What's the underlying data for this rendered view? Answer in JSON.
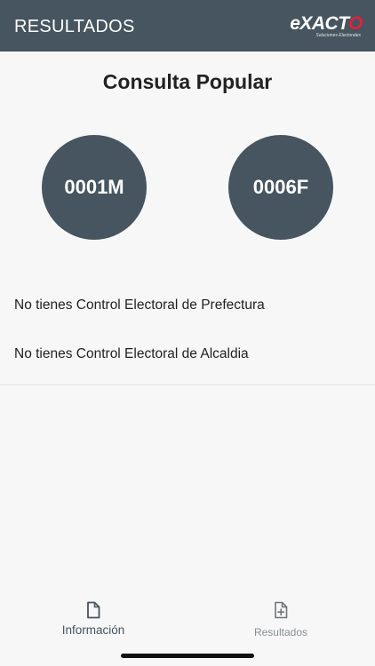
{
  "header": {
    "title": "RESULTADOS",
    "logo_text_main": "eXACT",
    "logo_text_accent": "O",
    "logo_tagline": "Soluciones Electorales",
    "background_color": "#46555f",
    "logo_accent_color": "#e0223a"
  },
  "main": {
    "title": "Consulta Popular",
    "codes": [
      "0001M",
      "0006F"
    ],
    "messages": [
      "No tienes Control Electoral de Prefectura",
      "No tienes Control Electoral de Alcaldia"
    ]
  },
  "tabs": [
    {
      "label": "Información",
      "icon": "document-icon",
      "selected": true
    },
    {
      "label": "Resultados",
      "icon": "document-plus-icon",
      "selected": false
    }
  ]
}
